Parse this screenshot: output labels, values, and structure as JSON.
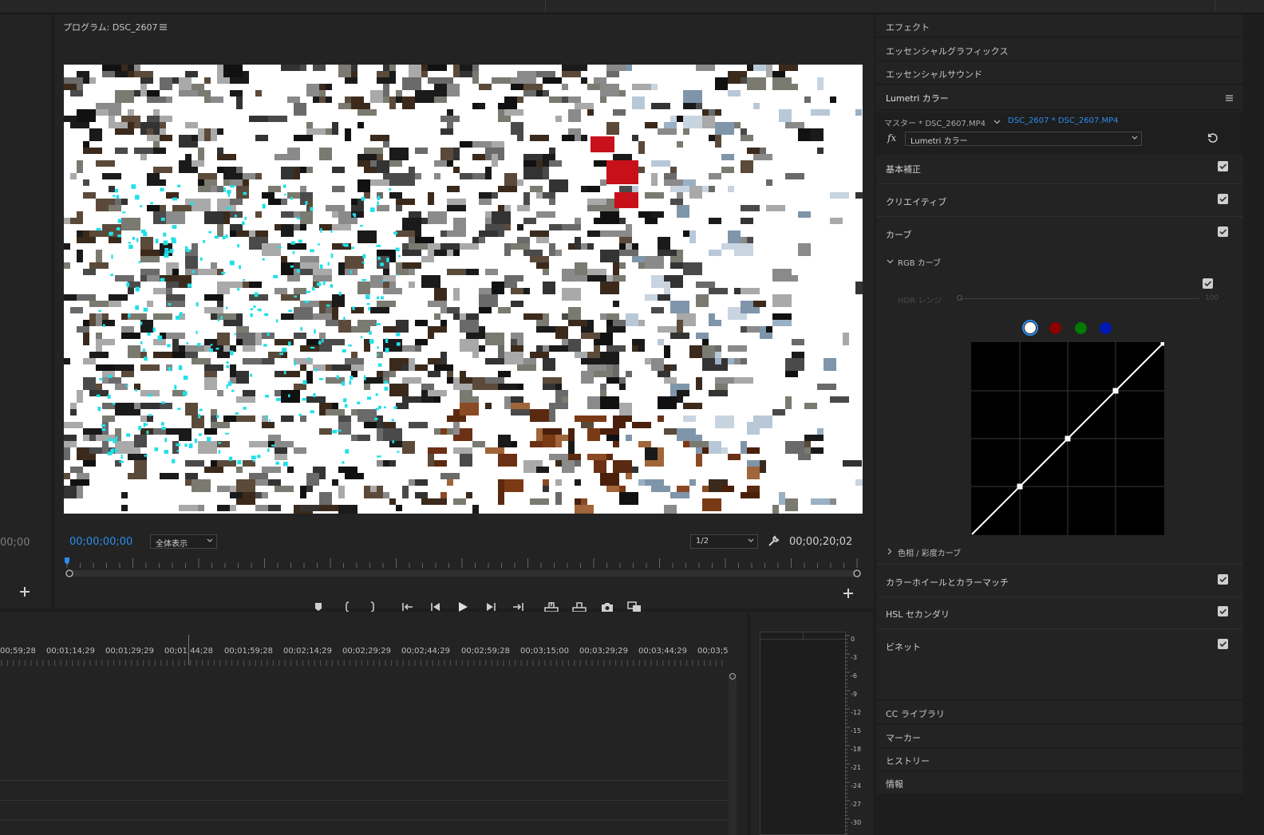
{
  "program_monitor": {
    "title": "プログラム: DSC_2607",
    "timecode_current": "00;00;00;00",
    "timecode_duration": "00;00;20;02",
    "zoom_select": "全体表示",
    "resolution_select": "1/2"
  },
  "left_panel": {
    "timecode": "00;00"
  },
  "right_panel": {
    "tabs": [
      "エフェクト",
      "エッセンシャルグラフィックス",
      "エッセンシャルサウンド"
    ],
    "lumetri_title": "Lumetri カラー",
    "source_master": "マスター * DSC_2607.MP4",
    "source_clip": "DSC_2607 * DSC_2607.MP4",
    "fx_label": "fx",
    "effect_select": "Lumetri カラー",
    "sections": [
      "基本補正",
      "クリエイティブ",
      "カーブ"
    ],
    "rgb_curve_label": "RGB カーブ",
    "hdr_label": "HDR レンジ",
    "hdr_value": "100",
    "hue_sat_label": "色相 / 彩度カーブ",
    "sections_after": [
      "カラーホイールとカラーマッチ",
      "HSL セカンダリ",
      "ビネット"
    ],
    "bottom_panels": [
      "CC ライブラリ",
      "マーカー",
      "ヒストリー",
      "情報"
    ],
    "colors": {
      "white": "#ffffff",
      "red": "#8b0000",
      "green": "#007a00",
      "blue": "#0018b4"
    }
  },
  "timeline": {
    "ticks": [
      "00;59;28",
      "00;01;14;29",
      "00;01;29;29",
      "00;01;44;28",
      "00;01;59;28",
      "00;02;14;29",
      "00;02;29;29",
      "00;02;44;29",
      "00;02;59;28",
      "00;03;15;00",
      "00;03;29;29",
      "00;03;44;29",
      "00;03;5"
    ]
  },
  "audio_meter": {
    "db_labels": [
      "0",
      "-3",
      "-6",
      "-9",
      "-12",
      "-15",
      "-18",
      "-21",
      "-24",
      "-27",
      "-30"
    ]
  },
  "curve": {
    "points": [
      [
        0,
        0
      ],
      [
        0.25,
        0.25
      ],
      [
        0.5,
        0.5
      ],
      [
        0.75,
        0.75
      ],
      [
        1,
        1
      ]
    ]
  }
}
